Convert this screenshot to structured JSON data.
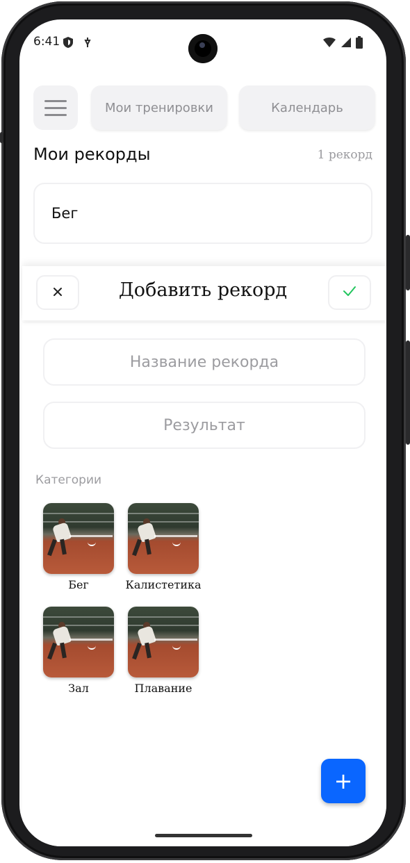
{
  "status_bar": {
    "time": "6:41",
    "left_icons": [
      "shield-icon",
      "bolt-icon"
    ],
    "right_icons": [
      "wifi-icon",
      "signal-icon",
      "battery-icon"
    ]
  },
  "top_bar": {
    "menu_icon": "hamburger-icon",
    "tabs": [
      {
        "label": "Мои тренировки"
      },
      {
        "label": "Календарь"
      }
    ]
  },
  "records": {
    "title": "Мои рекорды",
    "count": "1 рекорд",
    "items": [
      {
        "name": "Бег"
      }
    ]
  },
  "add_record_sheet": {
    "title": "Добавить рекорд",
    "close_icon": "close-icon",
    "confirm_icon": "check-icon",
    "accent_check": "#22c55e",
    "fields": {
      "name_placeholder": "Название рекорда",
      "result_placeholder": "Результат"
    },
    "categories_label": "Категории",
    "categories": [
      {
        "name": "Бег"
      },
      {
        "name": "Калистетика"
      },
      {
        "name": "Зал"
      },
      {
        "name": "Плавание"
      }
    ]
  },
  "fab": {
    "label": "+",
    "color": "#0a66ff"
  }
}
